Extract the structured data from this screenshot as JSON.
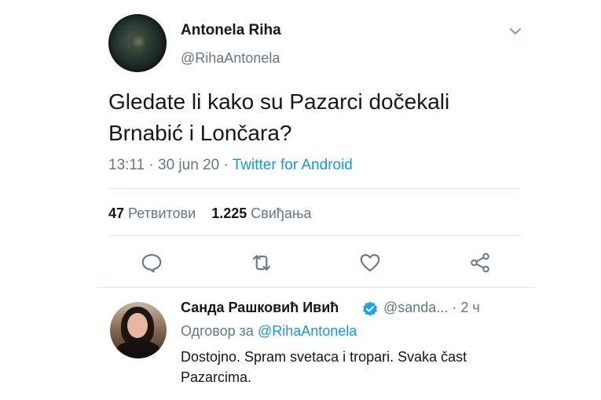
{
  "tweet": {
    "author_name": "Antonela Riha",
    "author_handle": "@RihaAntonela",
    "text_line1": "Gledate li kako su Pazarci dočekali",
    "text_line2": "Brnabić i Lončara?",
    "time_date": "13:11 · 30 jun 20 · ",
    "source": "Twitter for Android",
    "retweets_count": "47",
    "retweets_label": "Ретвитови",
    "likes_count": "1.225",
    "likes_label": "Свиђања",
    "icons": [
      "chevron-down-icon",
      "reply-icon",
      "retweet-icon",
      "like-icon",
      "share-icon"
    ]
  },
  "reply": {
    "author_name": "Санда Рашковић Ивић",
    "author_handle_time": "@sanda... · 2 ч",
    "reply_to_label": "Одговор за ",
    "reply_to_handle": "@RihaAntonela",
    "text_line1": "Dostojno. Spram svetaca i tropari. Svaka čast",
    "text_line2": "Pazarcima.",
    "verified_icon": "verified-badge-icon"
  },
  "colors": {
    "text": "#14171a",
    "muted": "#657786",
    "link": "#1b95e0",
    "divider": "#e1e8ed"
  }
}
